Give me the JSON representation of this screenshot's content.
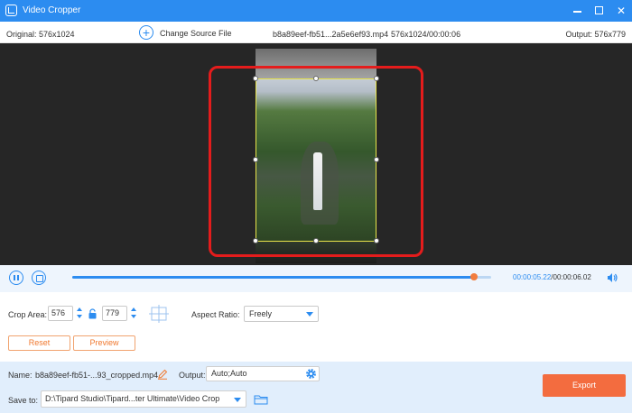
{
  "window": {
    "title": "Video Cropper",
    "icon": "crop-app-icon"
  },
  "infobar": {
    "original": "Original: 576x1024",
    "change_source": "Change Source File",
    "file_name": "b8a89eef-fb51...2a5e6ef93.mp4",
    "file_meta": "576x1024/00:00:06",
    "output": "Output: 576x779"
  },
  "playback": {
    "current_time": "00:00:05.22",
    "separator": "/",
    "total_time": "00:00:06.02",
    "progress": 0.96
  },
  "crop": {
    "label": "Crop Area:",
    "width": "576",
    "height": "779",
    "aspect_label": "Aspect Ratio:",
    "aspect_value": "Freely"
  },
  "buttons": {
    "reset": "Reset",
    "preview": "Preview",
    "export": "Export"
  },
  "output": {
    "name_label": "Name:",
    "name_value": "b8a89eef-fb51-...93_cropped.mp4",
    "output_label": "Output:",
    "output_value": "Auto;Auto",
    "save_label": "Save to:",
    "save_value": "D:\\Tipard Studio\\Tipard...ter Ultimate\\Video Crop"
  },
  "colors": {
    "accent": "#2c8cf0",
    "orange": "#f36c3f",
    "highlight": "#e41c1c"
  }
}
